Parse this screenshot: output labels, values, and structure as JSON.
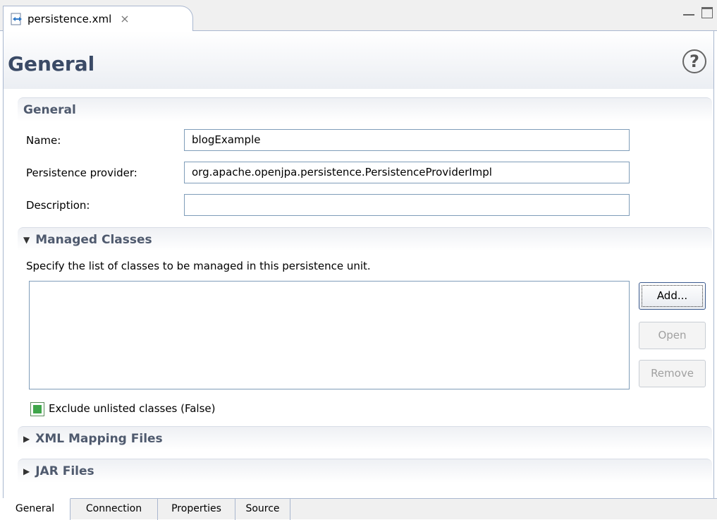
{
  "editor_tab": {
    "label": "persistence.xml",
    "close_glyph": "⨯",
    "icon": "xml-file-icon"
  },
  "window_controls": {
    "minimize_icon": "minimize-icon",
    "maximize_icon": "maximize-icon"
  },
  "header": {
    "title": "General",
    "help_glyph": "?",
    "help_icon": "help-icon"
  },
  "general_section": {
    "title": "General",
    "fields": {
      "name_label": "Name:",
      "name_value": "blogExample",
      "provider_label": "Persistence provider:",
      "provider_value": "org.apache.openjpa.persistence.PersistenceProviderImpl",
      "description_label": "Description:",
      "description_value": ""
    }
  },
  "managed_classes": {
    "title": "Managed Classes",
    "expanded": true,
    "twisty_glyph": "▼",
    "description": "Specify the list of classes to be managed in this persistence unit.",
    "items": [],
    "buttons": {
      "add": "Add...",
      "open": "Open",
      "remove": "Remove"
    },
    "exclude_unlisted_label": "Exclude unlisted classes (False)"
  },
  "xml_mapping_files": {
    "title": "XML Mapping Files",
    "expanded": false,
    "twisty_glyph": "▶"
  },
  "jar_files": {
    "title": "JAR Files",
    "expanded": false,
    "twisty_glyph": "▶"
  },
  "bottom_tabs": [
    {
      "label": "General",
      "active": true
    },
    {
      "label": "Connection",
      "active": false
    },
    {
      "label": "Properties",
      "active": false
    },
    {
      "label": "Source",
      "active": false
    }
  ],
  "colors": {
    "title": "#3a4a66",
    "section_title": "#4f5a6e",
    "border": "#a9b7cf",
    "checkbox_fill": "#3fa64a"
  }
}
